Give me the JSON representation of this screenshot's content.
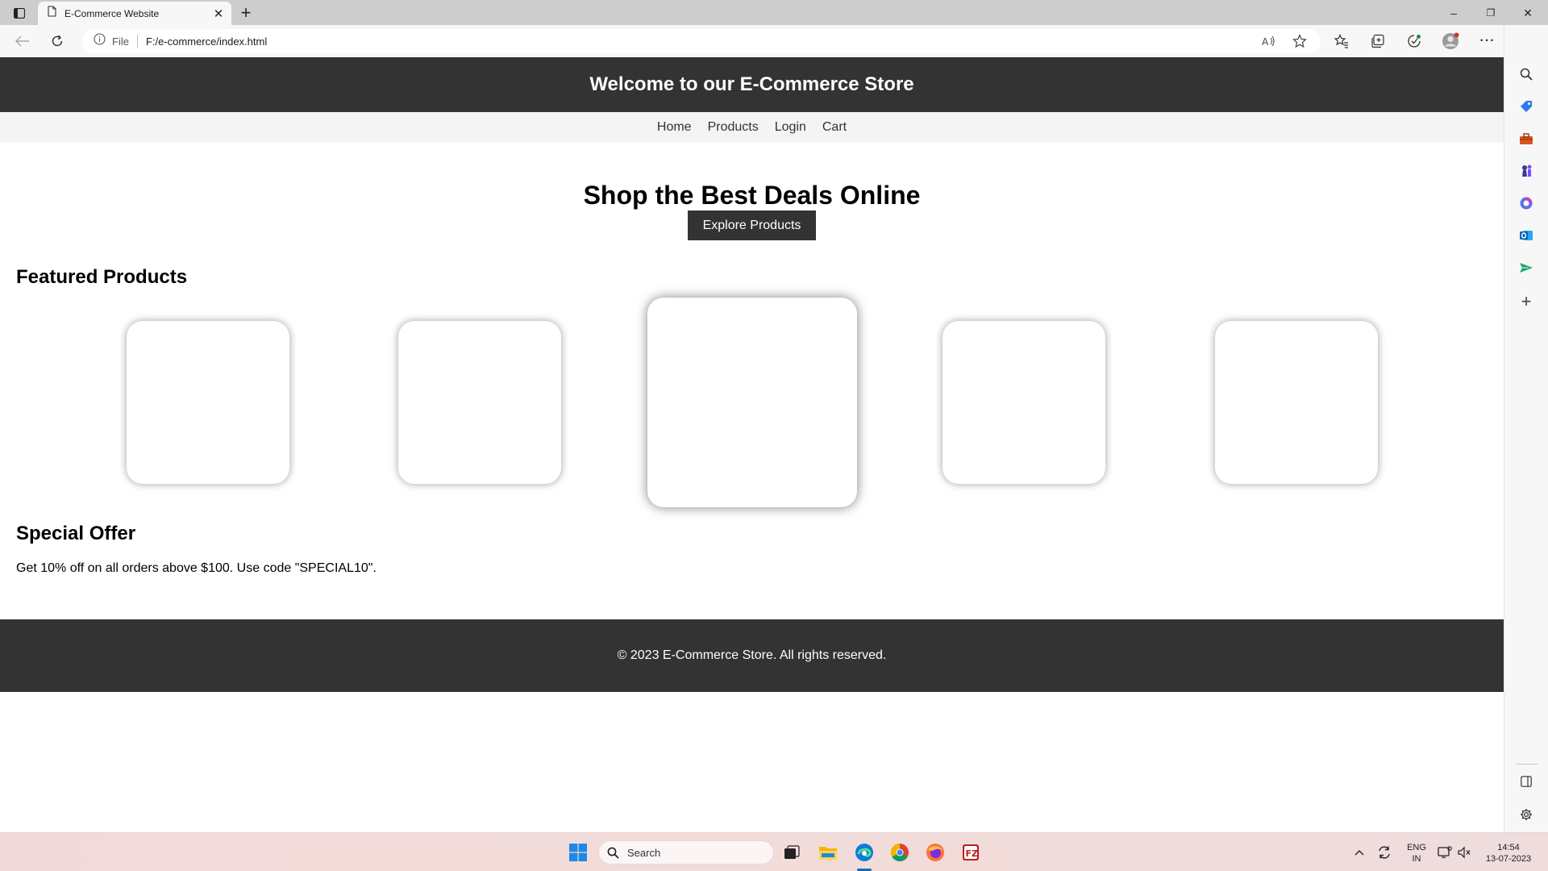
{
  "browser": {
    "tab_title": "E-Commerce Website",
    "close_glyph": "✕",
    "new_tab_glyph": "+",
    "address_scheme": "File",
    "address_url": "F:/e-commerce/index.html",
    "window_controls": {
      "minimize": "–",
      "restore": "❐",
      "close": "✕"
    },
    "more_glyph": "···"
  },
  "site": {
    "header_title": "Welcome to our E-Commerce Store",
    "nav": [
      "Home",
      "Products",
      "Login",
      "Cart"
    ],
    "hero_title": "Shop the Best Deals Online",
    "hero_button": "Explore Products",
    "featured_title": "Featured Products",
    "featured_count": 5,
    "featured_active_index": 2,
    "offer_title": "Special Offer",
    "offer_text": "Get 10% off on all orders above $100. Use code \"SPECIAL10\".",
    "footer_text": "© 2023 E-Commerce Store. All rights reserved."
  },
  "taskbar": {
    "search_placeholder": "Search",
    "lang_line1": "ENG",
    "lang_line2": "IN",
    "time": "14:54",
    "date": "13-07-2023"
  },
  "colors": {
    "header_bg": "#333333",
    "nav_bg": "#f4f4f4",
    "accent_edge": "#0078d4"
  },
  "icons": {
    "sidebar": [
      "search-icon",
      "shopping-tag-icon",
      "toolbox-icon",
      "chess-icon",
      "office-icon",
      "outlook-icon",
      "send-icon",
      "add-icon"
    ]
  }
}
